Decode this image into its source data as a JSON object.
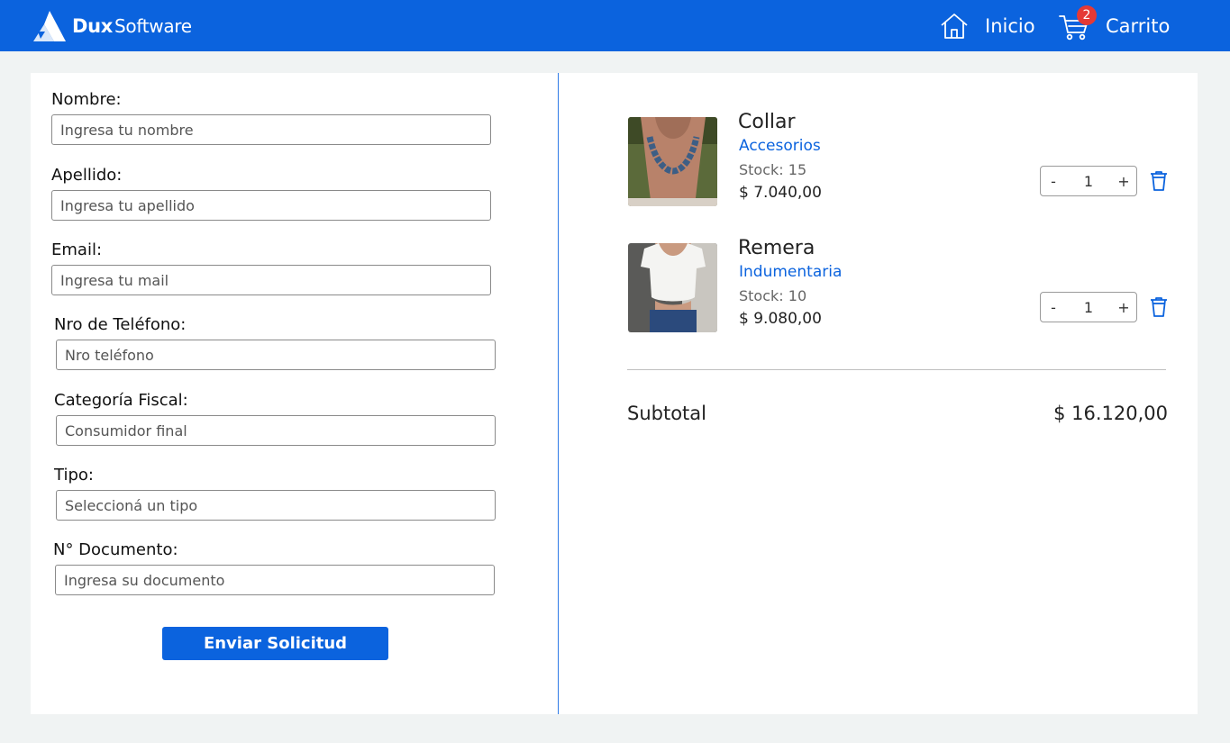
{
  "brand": {
    "name_bold": "Dux",
    "name_regular": "Software"
  },
  "nav": {
    "home_label": "Inicio",
    "cart_label": "Carrito",
    "cart_count": "2"
  },
  "form": {
    "nombre": {
      "label": "Nombre:",
      "placeholder": "Ingresa tu nombre"
    },
    "apellido": {
      "label": "Apellido:",
      "placeholder": "Ingresa tu apellido"
    },
    "email": {
      "label": "Email:",
      "placeholder": "Ingresa tu mail"
    },
    "telefono": {
      "label": "Nro de Teléfono:",
      "placeholder": "Nro teléfono"
    },
    "categoria": {
      "label": "Categoría Fiscal:",
      "placeholder": "Consumidor final"
    },
    "tipo": {
      "label": "Tipo:",
      "placeholder": "Seleccioná un tipo"
    },
    "documento": {
      "label": "N° Documento:",
      "placeholder": "Ingresa su documento"
    },
    "submit_label": "Enviar Solicitud"
  },
  "cart": {
    "items": [
      {
        "name": "Collar",
        "category": "Accesorios",
        "stock": "Stock: 15",
        "price": "$ 7.040,00",
        "quantity": "1",
        "minus": "-",
        "plus": "+"
      },
      {
        "name": "Remera",
        "category": "Indumentaria",
        "stock": "Stock: 10",
        "price": "$ 9.080,00",
        "quantity": "1",
        "minus": "-",
        "plus": "+"
      }
    ],
    "subtotal_label": "Subtotal",
    "subtotal_value": "$ 16.120,00"
  },
  "colors": {
    "primary": "#0b63de",
    "badge": "#e53935",
    "page_bg": "#f0f3f3"
  }
}
